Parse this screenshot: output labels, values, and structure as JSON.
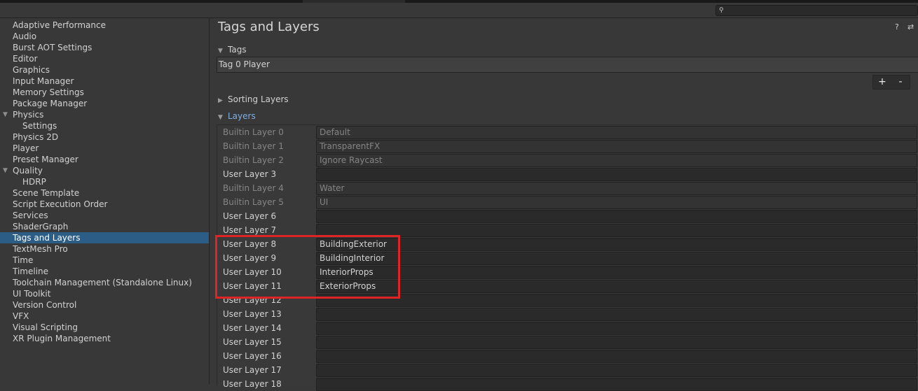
{
  "sidebar": {
    "items": [
      {
        "label": "Adaptive Performance",
        "indent": 0
      },
      {
        "label": "Audio",
        "indent": 0
      },
      {
        "label": "Burst AOT Settings",
        "indent": 0
      },
      {
        "label": "Editor",
        "indent": 0
      },
      {
        "label": "Graphics",
        "indent": 0
      },
      {
        "label": "Input Manager",
        "indent": 0
      },
      {
        "label": "Memory Settings",
        "indent": 0
      },
      {
        "label": "Package Manager",
        "indent": 0
      },
      {
        "label": "Physics",
        "indent": 0,
        "expanded": true
      },
      {
        "label": "Settings",
        "indent": 1
      },
      {
        "label": "Physics 2D",
        "indent": 0
      },
      {
        "label": "Player",
        "indent": 0
      },
      {
        "label": "Preset Manager",
        "indent": 0
      },
      {
        "label": "Quality",
        "indent": 0,
        "expanded": true
      },
      {
        "label": "HDRP",
        "indent": 1
      },
      {
        "label": "Scene Template",
        "indent": 0
      },
      {
        "label": "Script Execution Order",
        "indent": 0
      },
      {
        "label": "Services",
        "indent": 0
      },
      {
        "label": "ShaderGraph",
        "indent": 0
      },
      {
        "label": "Tags and Layers",
        "indent": 0,
        "selected": true
      },
      {
        "label": "TextMesh Pro",
        "indent": 0
      },
      {
        "label": "Time",
        "indent": 0
      },
      {
        "label": "Timeline",
        "indent": 0
      },
      {
        "label": "Toolchain Management (Standalone Linux)",
        "indent": 0
      },
      {
        "label": "UI Toolkit",
        "indent": 0
      },
      {
        "label": "Version Control",
        "indent": 0
      },
      {
        "label": "VFX",
        "indent": 0
      },
      {
        "label": "Visual Scripting",
        "indent": 0
      },
      {
        "label": "XR Plugin Management",
        "indent": 0
      }
    ]
  },
  "main": {
    "title": "Tags and Layers",
    "help_icon": "?",
    "settings_icon": "⇄",
    "tags": {
      "label": "Tags",
      "entries": [
        "Tag 0   Player"
      ],
      "add_label": "+",
      "remove_label": "-"
    },
    "sorting_layers": {
      "label": "Sorting Layers"
    },
    "layers": {
      "label": "Layers",
      "rows": [
        {
          "name": "Builtin Layer 0",
          "value": "Default",
          "builtin": true
        },
        {
          "name": "Builtin Layer 1",
          "value": "TransparentFX",
          "builtin": true
        },
        {
          "name": "Builtin Layer 2",
          "value": "Ignore Raycast",
          "builtin": true
        },
        {
          "name": "User Layer 3",
          "value": "",
          "builtin": false
        },
        {
          "name": "Builtin Layer 4",
          "value": "Water",
          "builtin": true
        },
        {
          "name": "Builtin Layer 5",
          "value": "UI",
          "builtin": true
        },
        {
          "name": "User Layer 6",
          "value": "",
          "builtin": false
        },
        {
          "name": "User Layer 7",
          "value": "",
          "builtin": false
        },
        {
          "name": "User Layer 8",
          "value": "BuildingExterior",
          "builtin": false
        },
        {
          "name": "User Layer 9",
          "value": "BuildingInterior",
          "builtin": false
        },
        {
          "name": "User Layer 10",
          "value": "InteriorProps",
          "builtin": false
        },
        {
          "name": "User Layer 11",
          "value": "ExteriorProps",
          "builtin": false
        },
        {
          "name": "User Layer 12",
          "value": "",
          "builtin": false
        },
        {
          "name": "User Layer 13",
          "value": "",
          "builtin": false
        },
        {
          "name": "User Layer 14",
          "value": "",
          "builtin": false
        },
        {
          "name": "User Layer 15",
          "value": "",
          "builtin": false
        },
        {
          "name": "User Layer 16",
          "value": "",
          "builtin": false
        },
        {
          "name": "User Layer 17",
          "value": "",
          "builtin": false
        },
        {
          "name": "User Layer 18",
          "value": "",
          "builtin": false
        }
      ]
    }
  },
  "colors": {
    "background": "#383838",
    "selection": "#2c5d87",
    "accent_blue": "#7bb0e8",
    "highlight_red": "#e02424"
  }
}
